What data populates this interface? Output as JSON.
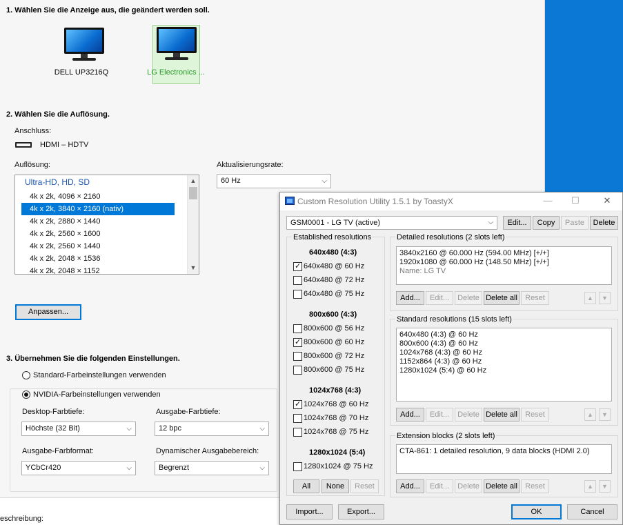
{
  "nvidia": {
    "section1_title": "1. Wählen Sie die Anzeige aus, die geändert werden soll.",
    "displays": [
      {
        "name": "DELL UP3216Q",
        "selected": false
      },
      {
        "name": "LG Electronics ...",
        "selected": true
      }
    ],
    "section2_title": "2. Wählen Sie die Auflösung.",
    "connection_label": "Anschluss:",
    "connection_value": "HDMI – HDTV",
    "resolution_label": "Auflösung:",
    "resolution_group": "Ultra-HD, HD, SD",
    "resolutions": [
      "4k x 2k, 4096 × 2160",
      "4k x 2k, 3840 × 2160 (nativ)",
      "4k x 2k, 2880 × 1440",
      "4k x 2k, 2560 × 1600",
      "4k x 2k, 2560 × 1440",
      "4k x 2k, 2048 × 1536",
      "4k x 2k, 2048 × 1152"
    ],
    "selected_resolution_index": 1,
    "refresh_label": "Aktualisierungsrate:",
    "refresh_value": "60 Hz",
    "customize_button": "Anpassen...",
    "section3_title": "3. Übernehmen Sie die folgenden Einstellungen.",
    "radio_default": "Standard-Farbeinstellungen verwenden",
    "radio_nvidia": "NVIDIA-Farbeinstellungen verwenden",
    "desktop_depth_label": "Desktop-Farbtiefe:",
    "desktop_depth_value": "Höchste (32 Bit)",
    "output_depth_label": "Ausgabe-Farbtiefe:",
    "output_depth_value": "12 bpc",
    "output_format_label": "Ausgabe-Farbformat:",
    "output_format_value": "YCbCr420",
    "dynamic_range_label": "Dynamischer Ausgabebereich:",
    "dynamic_range_value": "Begrenzt",
    "description_label": "eschreibung:"
  },
  "cru": {
    "title": "Custom Resolution Utility 1.5.1 by ToastyX",
    "window_controls": {
      "minimize": "—",
      "maximize": "☐",
      "close": "✕"
    },
    "monitor_select": "GSM0001 - LG TV (active)",
    "top_buttons": {
      "edit": "Edit...",
      "copy": "Copy",
      "paste": "Paste",
      "delete": "Delete"
    },
    "established": {
      "title": "Established resolutions",
      "groups": [
        {
          "heading": "640x480 (4:3)",
          "items": [
            {
              "label": "640x480 @ 60 Hz",
              "checked": true
            },
            {
              "label": "640x480 @ 72 Hz",
              "checked": false
            },
            {
              "label": "640x480 @ 75 Hz",
              "checked": false
            }
          ]
        },
        {
          "heading": "800x600 (4:3)",
          "items": [
            {
              "label": "800x600 @ 56 Hz",
              "checked": false
            },
            {
              "label": "800x600 @ 60 Hz",
              "checked": true
            },
            {
              "label": "800x600 @ 72 Hz",
              "checked": false
            },
            {
              "label": "800x600 @ 75 Hz",
              "checked": false
            }
          ]
        },
        {
          "heading": "1024x768 (4:3)",
          "items": [
            {
              "label": "1024x768 @ 60 Hz",
              "checked": true
            },
            {
              "label": "1024x768 @ 70 Hz",
              "checked": false
            },
            {
              "label": "1024x768 @ 75 Hz",
              "checked": false
            }
          ]
        },
        {
          "heading": "1280x1024 (5:4)",
          "items": [
            {
              "label": "1280x1024 @ 75 Hz",
              "checked": false
            }
          ]
        }
      ],
      "buttons": {
        "all": "All",
        "none": "None",
        "reset": "Reset"
      }
    },
    "detailed": {
      "title": "Detailed resolutions (2 slots left)",
      "lines": [
        "3840x2160 @ 60.000 Hz (594.00 MHz) [+/+]",
        "1920x1080 @ 60.000 Hz (148.50 MHz) [+/+]"
      ],
      "name_line": "Name: LG TV"
    },
    "standard": {
      "title": "Standard resolutions (15 slots left)",
      "lines": [
        "640x480 (4:3) @ 60 Hz",
        "800x600 (4:3) @ 60 Hz",
        "1024x768 (4:3) @ 60 Hz",
        "1152x864 (4:3) @ 60 Hz",
        "1280x1024 (5:4) @ 60 Hz"
      ]
    },
    "extension": {
      "title": "Extension blocks (2 slots left)",
      "lines": [
        "CTA-861: 1 detailed resolution, 9 data blocks (HDMI 2.0)"
      ]
    },
    "row_buttons": {
      "add": "Add...",
      "edit": "Edit...",
      "delete": "Delete",
      "delete_all": "Delete all",
      "reset": "Reset"
    },
    "arrows": {
      "up": "▲",
      "down": "▼"
    },
    "bottom_buttons": {
      "import": "Import...",
      "export": "Export...",
      "ok": "OK",
      "cancel": "Cancel"
    }
  }
}
